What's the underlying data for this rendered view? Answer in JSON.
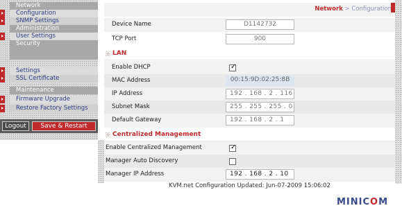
{
  "sidebar": {
    "sections": [
      {
        "title": "Network",
        "items": [
          "Configuration",
          "SNMP Settings"
        ]
      },
      {
        "title": "Administration",
        "items": [
          "User Settings"
        ]
      },
      {
        "title": "Security",
        "items": [
          "Settings",
          "SSL Certificate"
        ]
      },
      {
        "title": "Maintenance",
        "items": [
          "Firmware Upgrade",
          "Restore Factory Settings"
        ]
      }
    ],
    "logout_label": "Logout",
    "save_restart_label": "Save & Restart"
  },
  "breadcrumb": {
    "section": "Network",
    "separator": " > ",
    "page": "Configuration"
  },
  "general": {
    "device_name_label": "Device Name",
    "device_name": "D1142732",
    "tcp_port_label": "TCP Port",
    "tcp_port": "900"
  },
  "lan": {
    "title": "LAN",
    "dhcp_label": "Enable DHCP",
    "dhcp_checked": true,
    "mac_label": "MAC Address",
    "mac": "00:15:9D:02:25:8B",
    "ip_label": "IP Address",
    "ip": "192 . 168 .  2  . 116",
    "subnet_label": "Subnet Mask",
    "subnet": "255 . 255 . 255 .  0",
    "gateway_label": "Default Gateway",
    "gateway": "192 . 168 .  2  .  1"
  },
  "central": {
    "title": "Centralized Management",
    "enable_label": "Enable Centralized Management",
    "enable_checked": true,
    "auto_label": "Manager Auto Discovery",
    "auto_checked": false,
    "manager_ip_label": "Manager IP Address",
    "manager_ip": "192 . 168 .  2  . 10"
  },
  "footer": {
    "status": "KVM.net Configuration Updated: Jun-07-2009 15:06:02"
  },
  "logo": {
    "pre": "MINIC",
    "o": "O",
    "post": "M"
  },
  "colors": {
    "accent": "#c0292b",
    "nav_text": "#2f3c86",
    "section_head": "#a8a8a8"
  }
}
